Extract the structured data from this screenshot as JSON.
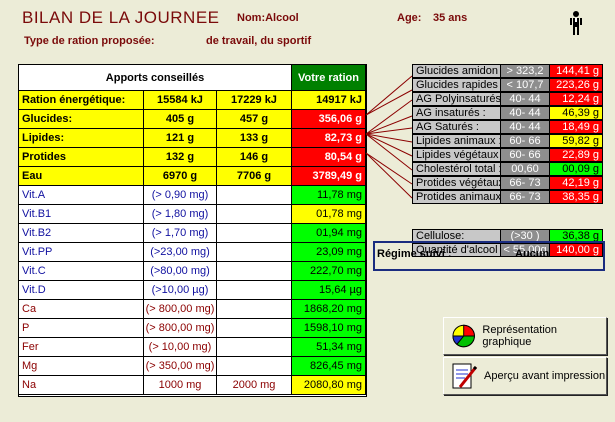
{
  "header": {
    "title": "BILAN DE LA JOURNEE",
    "nom_label": "Nom:",
    "nom_value": "Alcool",
    "age_label": "Age:",
    "age_value": "35 ans",
    "ration_label": "Type de ration proposée:",
    "ration_value": "de travail, du sportif"
  },
  "main_table": {
    "apports_header": "Apports conseillés",
    "votre_header": "Votre ration",
    "rows": [
      {
        "label": "Ration énergétique:",
        "min": "15584 kJ",
        "max": "17229 kJ",
        "val": "14917 kJ",
        "style": "y",
        "valstyle": "y"
      },
      {
        "label": "Glucides:",
        "min": "405 g",
        "max": "457 g",
        "val": "356,06 g",
        "style": "y",
        "valstyle": "r"
      },
      {
        "label": "Lipides:",
        "min": "121 g",
        "max": "133 g",
        "val": "82,73 g",
        "style": "y",
        "valstyle": "r"
      },
      {
        "label": "Protides",
        "min": "132 g",
        "max": "146 g",
        "val": "80,54 g",
        "style": "y",
        "valstyle": "r"
      },
      {
        "label": "Eau",
        "min": "6970 g",
        "max": "7706 g",
        "val": "3789,49 g",
        "style": "y",
        "valstyle": "r"
      },
      {
        "label": "Vit.A",
        "min": "(> 0,90 mg)",
        "max": "",
        "val": "11,78 mg",
        "style": "bl",
        "valstyle": "g"
      },
      {
        "label": "Vit.B1",
        "min": "(> 1,80 mg)",
        "max": "",
        "val": "01,78 mg",
        "style": "bl",
        "valstyle": "y2"
      },
      {
        "label": "Vit.B2",
        "min": "(> 1,70 mg)",
        "max": "",
        "val": "01,94 mg",
        "style": "bl",
        "valstyle": "g"
      },
      {
        "label": "Vit.PP",
        "min": "(>23,00 mg)",
        "max": "",
        "val": "23,09 mg",
        "style": "bl",
        "valstyle": "g"
      },
      {
        "label": "Vit.C",
        "min": "(>80,00 mg)",
        "max": "",
        "val": "222,70 mg",
        "style": "bl",
        "valstyle": "g"
      },
      {
        "label": "Vit.D",
        "min": "(>10,00 µg)",
        "max": "",
        "val": "15,64 µg",
        "style": "bl",
        "valstyle": "g"
      },
      {
        "label": "Ca",
        "min": "(> 800,00 mg)",
        "max": "",
        "val": "1868,20 mg",
        "style": "mr",
        "valstyle": "g"
      },
      {
        "label": "P",
        "min": "(> 800,00 mg)",
        "max": "",
        "val": "1598,10 mg",
        "style": "mr",
        "valstyle": "g"
      },
      {
        "label": "Fer",
        "min": "(> 10,00 mg)",
        "max": "",
        "val": "51,34 mg",
        "style": "mr",
        "valstyle": "g"
      },
      {
        "label": "Mg",
        "min": "(> 350,00 mg)",
        "max": "",
        "val": "826,45 mg",
        "style": "mr",
        "valstyle": "g"
      },
      {
        "label": "Na",
        "min": "1000 mg",
        "max": "2000 mg",
        "val": "2080,80 mg",
        "style": "mr",
        "valstyle": "y2"
      }
    ]
  },
  "right_table": {
    "rows": [
      {
        "label": "Glucides amidon",
        "ref": "> 323,2",
        "val": "144,41 g",
        "valstyle": "r"
      },
      {
        "label": "Glucides rapides",
        "ref": "< 107,7",
        "val": "223,26 g",
        "valstyle": "r"
      },
      {
        "label": "AG Polyinsaturés:",
        "ref": "40- 44",
        "val": "12,24 g",
        "valstyle": "r"
      },
      {
        "label": "AG insaturés :",
        "ref": "40- 44",
        "val": "46,39 g",
        "valstyle": "y2"
      },
      {
        "label": "AG Saturés :",
        "ref": "40- 44",
        "val": "18,49 g",
        "valstyle": "r"
      },
      {
        "label": "Lipides animaux :",
        "ref": "60- 66",
        "val": "59,82 g",
        "valstyle": "y2"
      },
      {
        "label": "Lipides végétaux",
        "ref": "60- 66",
        "val": "22,89 g",
        "valstyle": "r"
      },
      {
        "label": "Cholestérol total :",
        "ref": "00,60",
        "val": "00,09 g",
        "valstyle": "g"
      },
      {
        "label": "Protides végétaux",
        "ref": "66- 73",
        "val": "42,19 g",
        "valstyle": "r"
      },
      {
        "label": "Protides animaux",
        "ref": "66- 73",
        "val": "38,35 g",
        "valstyle": "r"
      }
    ],
    "extra": [
      {
        "label": "Cellulose:",
        "ref": "(>30 )",
        "val": "36,38 g",
        "valstyle": "g"
      },
      {
        "label": "Quantité d'alcool",
        "ref": "< 55,00g",
        "val": "140,00 g",
        "valstyle": "r"
      }
    ]
  },
  "regime": {
    "label": "Régime suivi :",
    "value": "Aucun"
  },
  "buttons": {
    "graph": "Représentation graphique",
    "print": "Aperçu avant impression"
  },
  "colors": {
    "title": "#7A0A0A",
    "yellow": "#FFFF00",
    "green": "#00FF00",
    "red": "#FF0000",
    "header_green": "#008000",
    "frame_blue": "#1A2C80"
  }
}
